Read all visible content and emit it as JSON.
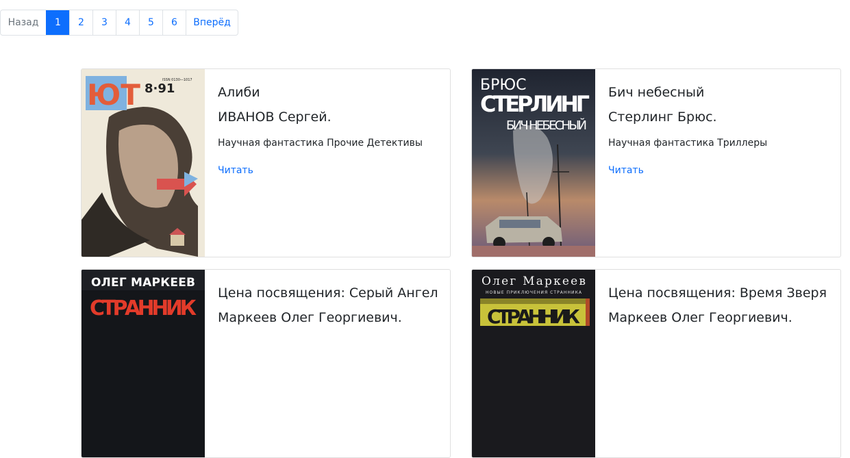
{
  "pagination": {
    "prev": "Назад",
    "pages": [
      "1",
      "2",
      "3",
      "4",
      "5",
      "6"
    ],
    "active": "1",
    "next": "Вперёд"
  },
  "books": [
    {
      "title": "Алиби",
      "author": "ИВАНОВ Сергей.",
      "genres": "Научная фантастика Прочие Детективы",
      "link": "Читать",
      "cover_text": [
        "ЮТ",
        "8·91",
        "ISSN 0130—1017"
      ]
    },
    {
      "title": "Бич небесный",
      "author": "Стерлинг Брюс.",
      "genres": "Научная фантастика Триллеры",
      "link": "Читать",
      "cover_text": [
        "БРЮС",
        "СТЕРЛИНГ",
        "БИЧ НЕБЕСНЫЙ"
      ]
    },
    {
      "title": "Цена посвящения: Серый Ангел",
      "author": "Маркеев Олег Георгиевич.",
      "genres": "",
      "link": "Читать",
      "cover_text": [
        "ОЛЕГ МАРКЕЕВ",
        "СТРАННИК"
      ]
    },
    {
      "title": "Цена посвящения: Время Зверя",
      "author": "Маркеев Олег Георгиевич.",
      "genres": "",
      "link": "Читать",
      "cover_text": [
        "Олег Маркеев",
        "НОВЫЕ ПРИКЛЮЧЕНИЯ СТРАННИКА",
        "СТРАННИК"
      ]
    }
  ],
  "colors": {
    "link": "#0d6efd",
    "active_page_bg": "#0d6efd"
  }
}
